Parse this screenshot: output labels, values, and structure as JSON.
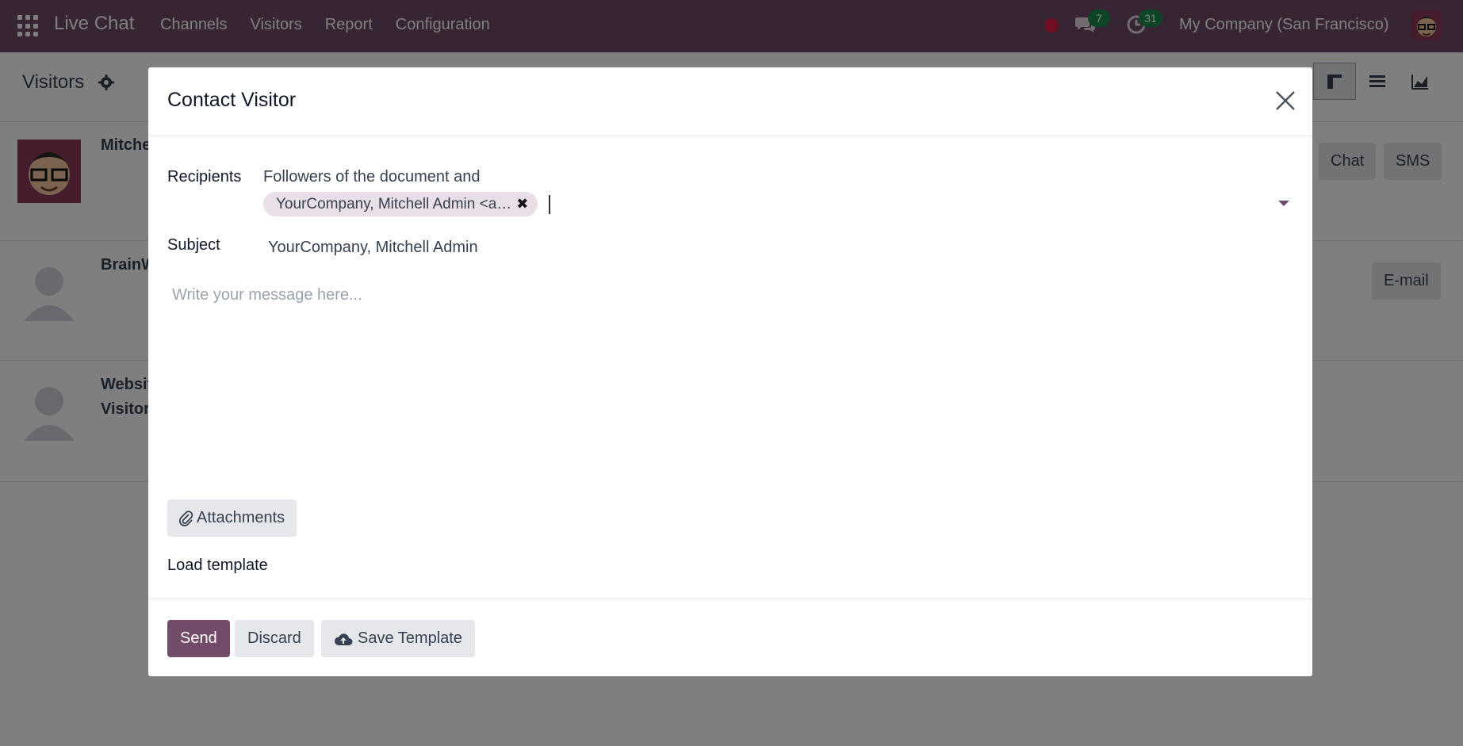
{
  "navbar": {
    "app_title": "Live Chat",
    "menu": [
      "Channels",
      "Visitors",
      "Report",
      "Configuration"
    ],
    "chat_count": "7",
    "activity_count": "31",
    "company": "My Company (San Francisco)"
  },
  "page": {
    "title": "Visitors",
    "cards": [
      {
        "name": "Mitchell Admin",
        "buttons": [
          "Chat",
          "SMS"
        ]
      },
      {
        "name": "BrainWeb",
        "buttons": [
          "E-mail"
        ]
      },
      {
        "name": "Website Visitor",
        "buttons": []
      }
    ]
  },
  "modal": {
    "title": "Contact Visitor",
    "recipients_label": "Recipients",
    "followers_text": "Followers of the document and",
    "recipient_tag": "YourCompany, Mitchell Admin <a…",
    "subject_label": "Subject",
    "subject_value": "YourCompany, Mitchell Admin",
    "message_placeholder": "Write your message here...",
    "attachments_label": "Attachments",
    "load_template_label": "Load template",
    "send_label": "Send",
    "discard_label": "Discard",
    "save_template_label": "Save Template"
  },
  "colors": {
    "brand": "#714b67",
    "badge": "#1a8a4a",
    "status_dot": "#e11d48"
  }
}
